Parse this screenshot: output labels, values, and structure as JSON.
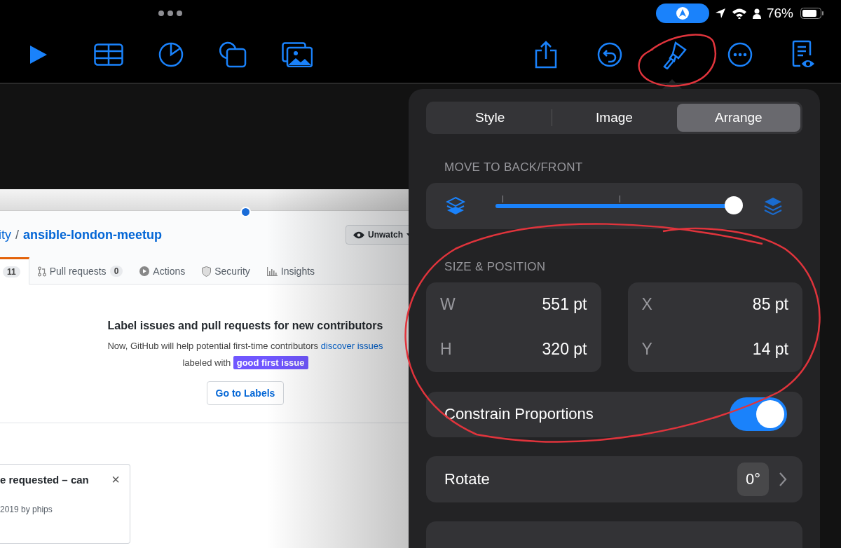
{
  "status_bar": {
    "battery": "76%"
  },
  "slide": {
    "breadcrumb": {
      "owner": "ity",
      "separator": "/",
      "repo": "ansible-london-meetup"
    },
    "watch_button": "Unwatch",
    "tabs": [
      {
        "count": "11",
        "selected": true
      },
      {
        "label": "Pull requests",
        "count": "0",
        "selected": false
      },
      {
        "label": "Actions",
        "selected": false
      },
      {
        "label": "Security",
        "selected": false
      },
      {
        "label": "Insights",
        "selected": false
      }
    ],
    "empty_state": {
      "heading": "Label issues and pull requests for new contributors",
      "text_before": "Now, GitHub will help potential first-time contributors",
      "link": "discover issues",
      "text_after": "labeled with",
      "label": "good first issue",
      "button": "Go to Labels"
    },
    "card": {
      "title": "e requested – can",
      "close": "×",
      "meta": "2019 by phips"
    }
  },
  "inspector": {
    "tabs": [
      {
        "label": "Style",
        "selected": false
      },
      {
        "label": "Image",
        "selected": false
      },
      {
        "label": "Arrange",
        "selected": true
      }
    ],
    "layer_section": "MOVE TO BACK/FRONT",
    "layer_slider": {
      "level": 1
    },
    "size_section": "SIZE & POSITION",
    "fields": [
      {
        "label": "W",
        "value": "551 pt"
      },
      {
        "label": "H",
        "value": "320 pt"
      },
      {
        "label": "X",
        "value": "85 pt"
      },
      {
        "label": "Y",
        "value": "14 pt"
      }
    ],
    "constrain": {
      "label": "Constrain Proportions",
      "on": true
    },
    "rotate": {
      "label": "Rotate",
      "value": "0°"
    }
  }
}
